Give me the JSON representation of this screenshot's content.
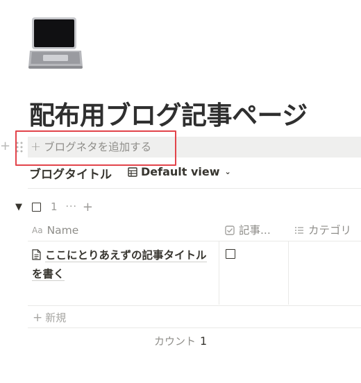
{
  "page": {
    "icon": "laptop-emoji-icon",
    "title": "配布用ブログ記事ページ"
  },
  "add_row": {
    "label": "ブログネタを追加する"
  },
  "database": {
    "title": "ブログタイトル",
    "view_label": "Default view"
  },
  "group": {
    "count": "1"
  },
  "table": {
    "columns": [
      {
        "label": "Name",
        "icon": "text-aa-icon"
      },
      {
        "label": "記事...",
        "icon": "checkbox-icon"
      },
      {
        "label": "カテゴリ",
        "icon": "list-icon"
      }
    ],
    "rows": [
      {
        "name": "ここにとりあえずの記事タイトルを書く",
        "checked": false
      }
    ],
    "new_label": "新規",
    "footer": {
      "count_label": "カウント",
      "count_value": "1"
    }
  }
}
